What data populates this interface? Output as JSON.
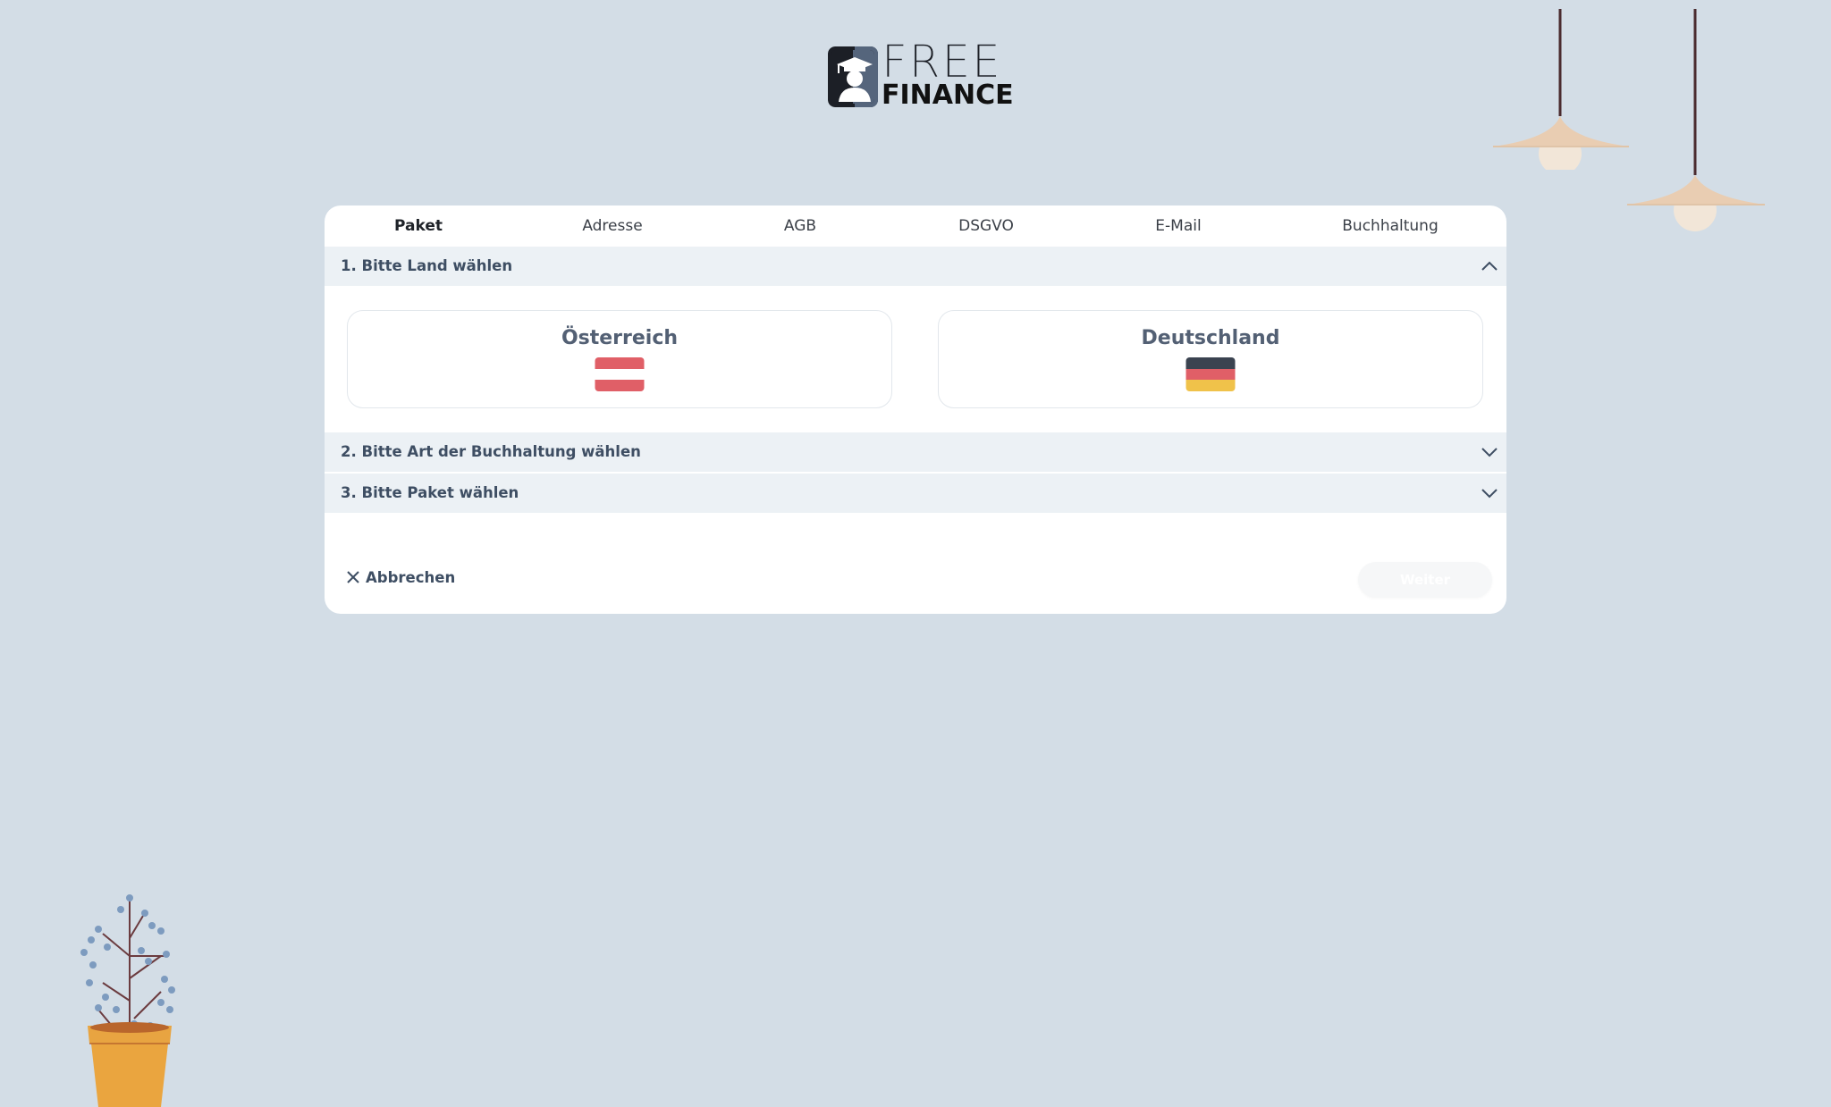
{
  "logo": {
    "line1": "FREE",
    "line2": "FINANCE"
  },
  "tabs": [
    {
      "label": "Paket",
      "active": true
    },
    {
      "label": "Adresse",
      "active": false
    },
    {
      "label": "AGB",
      "active": false
    },
    {
      "label": "DSGVO",
      "active": false
    },
    {
      "label": "E-Mail",
      "active": false
    },
    {
      "label": "Buchhaltung",
      "active": false
    }
  ],
  "sections": [
    {
      "title": "1. Bitte Land wählen",
      "expanded": true
    },
    {
      "title": "2. Bitte Art der Buchhaltung wählen",
      "expanded": false
    },
    {
      "title": "3. Bitte Paket wählen",
      "expanded": false
    }
  ],
  "countries": [
    {
      "name": "Österreich",
      "flag": "austria-flag"
    },
    {
      "name": "Deutschland",
      "flag": "germany-flag"
    }
  ],
  "actions": {
    "cancel_label": "Abbrechen",
    "next_label": "Weiter"
  },
  "colors": {
    "background": "#d3dde6",
    "section_header": "#ecf1f5",
    "text_primary": "#3e4e63",
    "austria_red": "#e05f67",
    "germany_black": "#3b4350",
    "germany_red": "#e05f67",
    "germany_gold": "#f0c24a"
  }
}
